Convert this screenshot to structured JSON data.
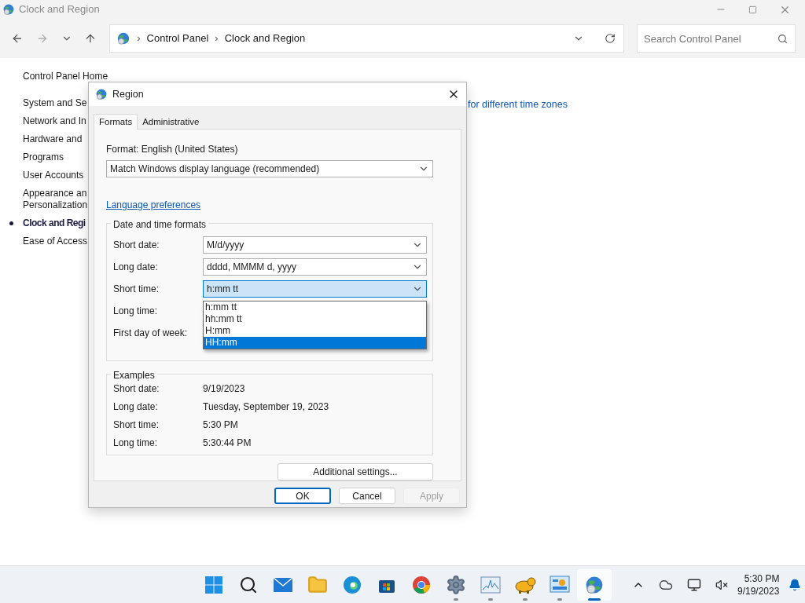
{
  "window": {
    "title": "Clock and Region"
  },
  "address": {
    "separator": "›",
    "crumbs": [
      "Control Panel",
      "Clock and Region"
    ],
    "search_placeholder": "Search Control Panel"
  },
  "sidebar": {
    "home": "Control Panel Home",
    "items": [
      {
        "label": "System and Se",
        "selected": false
      },
      {
        "label": "Network and In",
        "selected": false
      },
      {
        "label": "Hardware and",
        "selected": false
      },
      {
        "label": "Programs",
        "selected": false
      },
      {
        "label": "User Accounts",
        "selected": false
      },
      {
        "label": "Appearance an\nPersonalization",
        "selected": false
      },
      {
        "label": "Clock and Regi",
        "selected": true
      },
      {
        "label": "Ease of Access",
        "selected": false
      }
    ]
  },
  "content": {
    "link": "for different time zones"
  },
  "dialog": {
    "title": "Region",
    "tabs": [
      {
        "label": "Formats",
        "selected": true
      },
      {
        "label": "Administrative",
        "selected": false
      }
    ],
    "format_label": "Format: English (United States)",
    "format_value": "Match Windows display language (recommended)",
    "link": "Language preferences",
    "formats_group": {
      "title": "Date and time formats",
      "rows": [
        {
          "label": "Short date:",
          "value": "M/d/yyyy",
          "open": false
        },
        {
          "label": "Long date:",
          "value": "dddd, MMMM d, yyyy",
          "open": false
        },
        {
          "label": "Short time:",
          "value": "h:mm tt",
          "open": true
        },
        {
          "label": "Long time:"
        },
        {
          "label": "First day of week:"
        }
      ]
    },
    "dropdown": {
      "items": [
        {
          "label": "h:mm tt",
          "selected": false
        },
        {
          "label": "hh:mm tt",
          "selected": false
        },
        {
          "label": "H:mm",
          "selected": false
        },
        {
          "label": "HH:mm",
          "selected": true
        }
      ]
    },
    "examples": {
      "title": "Examples",
      "rows": [
        {
          "label": "Short date:",
          "value": "9/19/2023"
        },
        {
          "label": "Long date:",
          "value": "Tuesday, September 19, 2023"
        },
        {
          "label": "Short time:",
          "value": "5:30 PM"
        },
        {
          "label": "Long time:",
          "value": "5:30:44 PM"
        }
      ]
    },
    "additional_button": "Additional settings...",
    "buttons": [
      {
        "label": "OK",
        "kind": "default"
      },
      {
        "label": "Cancel",
        "kind": "normal"
      },
      {
        "label": "Apply",
        "kind": "disabled"
      }
    ]
  },
  "taskbar": {
    "apps": [
      {
        "kind": "start",
        "running": false,
        "active": false
      },
      {
        "kind": "search",
        "running": false,
        "active": false
      },
      {
        "kind": "mail",
        "running": false,
        "active": false
      },
      {
        "kind": "folder",
        "running": false,
        "active": false
      },
      {
        "kind": "edge",
        "running": false,
        "active": false
      },
      {
        "kind": "store",
        "running": false,
        "active": false
      },
      {
        "kind": "chrome",
        "running": false,
        "active": false
      },
      {
        "kind": "settings",
        "running": true,
        "active": false
      },
      {
        "kind": "monitor",
        "running": true,
        "active": false
      },
      {
        "kind": "sheep",
        "running": true,
        "active": false
      },
      {
        "kind": "panel",
        "running": true,
        "active": false
      },
      {
        "kind": "globe",
        "running": true,
        "active": true
      }
    ],
    "time": "5:30 PM",
    "date": "9/19/2023"
  }
}
